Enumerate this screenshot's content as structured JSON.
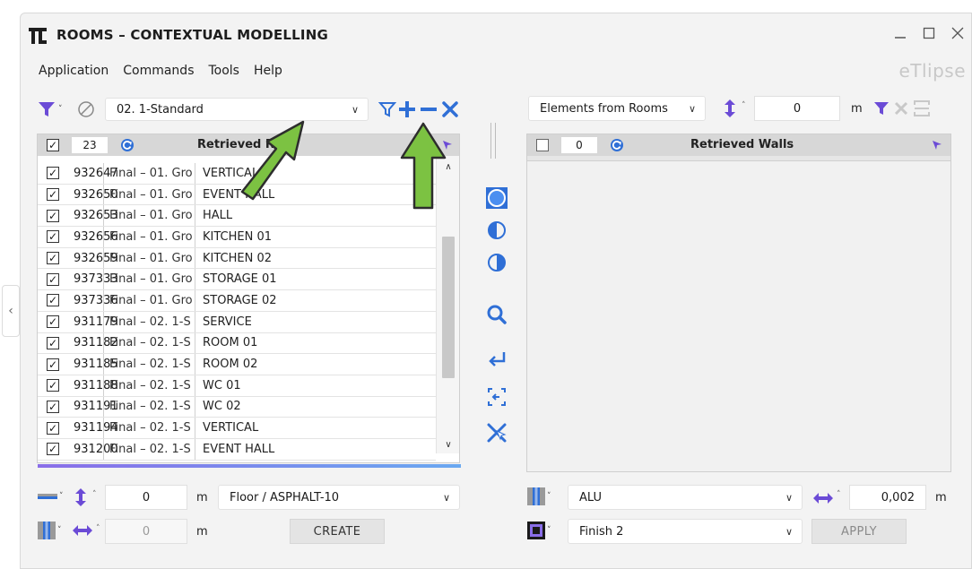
{
  "window": {
    "title": "ROOMS – CONTEXTUAL MODELLING",
    "brand": "eTlipse"
  },
  "menu": [
    "Application",
    "Commands",
    "Tools",
    "Help"
  ],
  "left": {
    "filter_value": "02. 1-Standard",
    "head_count": "23",
    "head_title": "Retrieved R",
    "rows": [
      {
        "id": "932647",
        "level": "Final – 01. Gro",
        "name": "VERTICAL"
      },
      {
        "id": "932650",
        "level": "Final – 01. Gro",
        "name": "EVENT HALL"
      },
      {
        "id": "932653",
        "level": "Final – 01. Gro",
        "name": "HALL"
      },
      {
        "id": "932656",
        "level": "Final – 01. Gro",
        "name": "KITCHEN 01"
      },
      {
        "id": "932659",
        "level": "Final – 01. Gro",
        "name": "KITCHEN 02"
      },
      {
        "id": "937333",
        "level": "Final – 01. Gro",
        "name": "STORAGE 01"
      },
      {
        "id": "937336",
        "level": "Final – 01. Gro",
        "name": "STORAGE 02"
      },
      {
        "id": "931179",
        "level": "Final – 02. 1-S",
        "name": "SERVICE"
      },
      {
        "id": "931182",
        "level": "Final – 02. 1-S",
        "name": "ROOM 01"
      },
      {
        "id": "931185",
        "level": "Final – 02. 1-S",
        "name": "ROOM 02"
      },
      {
        "id": "931188",
        "level": "Final – 02. 1-S",
        "name": "WC 01"
      },
      {
        "id": "931191",
        "level": "Final – 02. 1-S",
        "name": "WC 02"
      },
      {
        "id": "931194",
        "level": "Final – 02. 1-S",
        "name": "VERTICAL"
      },
      {
        "id": "931200",
        "level": "Final – 02. 1-S",
        "name": "EVENT HALL"
      }
    ],
    "offset_value": "0",
    "offset_unit": "m",
    "floor_type": "Floor / ASPHALT-10",
    "width_value": "0",
    "width_unit": "m",
    "create_label": "CREATE"
  },
  "right": {
    "source": "Elements from Rooms",
    "offset_value": "0",
    "offset_unit": "m",
    "head_count": "0",
    "head_title": "Retrieved Walls",
    "material": "ALU",
    "thickness_value": "0,002",
    "thickness_unit": "m",
    "finish": "Finish 2",
    "apply_label": "APPLY"
  },
  "colors": {
    "accent_blue": "#2f6fd6",
    "icon_purple": "#6b4bd6",
    "arrow_green": "#7cc242"
  }
}
